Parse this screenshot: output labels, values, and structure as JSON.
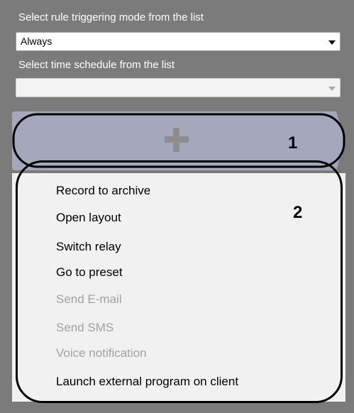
{
  "trigger_mode": {
    "label": "Select rule triggering mode from the list",
    "value": "Always"
  },
  "time_schedule": {
    "label": "Select time schedule from the list",
    "value": ""
  },
  "add_action": {
    "icon": "plus-icon",
    "callout": "1"
  },
  "action_menu": {
    "callout": "2",
    "items": [
      {
        "label": "Record to archive",
        "enabled": true
      },
      {
        "label": "Open layout",
        "enabled": true
      },
      {
        "label": "Switch relay",
        "enabled": true
      },
      {
        "label": "Go to preset",
        "enabled": true
      },
      {
        "label": "Send E-mail",
        "enabled": false
      },
      {
        "label": "Send SMS",
        "enabled": false
      },
      {
        "label": "Voice notification",
        "enabled": false
      },
      {
        "label": "Launch external program on client",
        "enabled": true
      }
    ]
  },
  "colors": {
    "panel_background": "#7b7b7b",
    "add_bar": "#a5a8bd",
    "menu_background": "#f1f1f1",
    "disabled_text": "#a1a1a1"
  }
}
